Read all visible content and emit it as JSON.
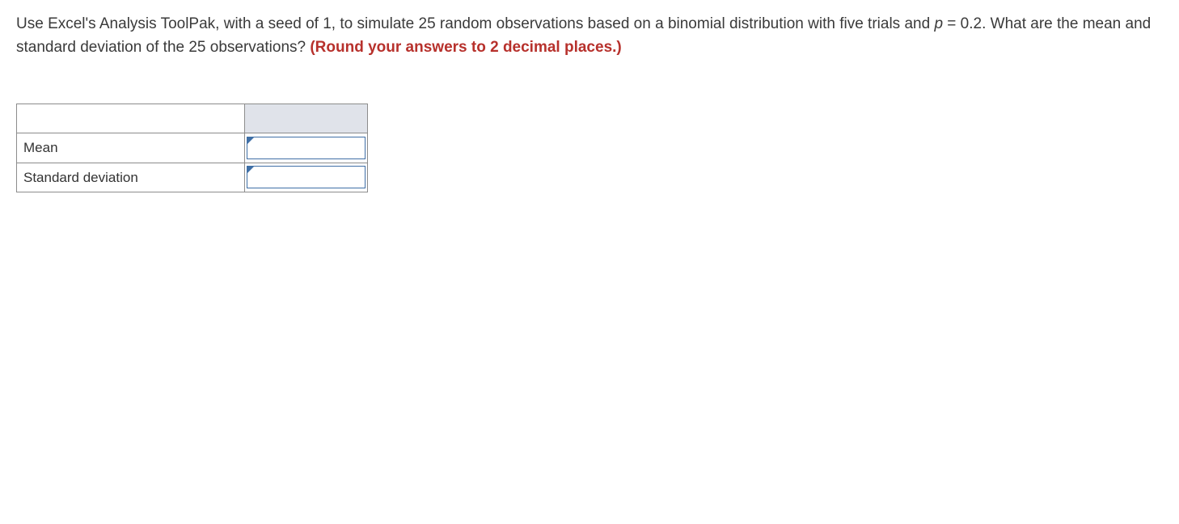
{
  "question": {
    "part1": "Use Excel's Analysis ToolPak, with a seed of 1, to simulate 25 random observations based on a binomial distribution with five trials and ",
    "italic_var": "p",
    "part2": " = 0.2. What are the mean and standard deviation of the 25 observations? ",
    "instruction": "(Round your answers to 2 decimal places.)"
  },
  "table": {
    "rows": [
      {
        "label": "Mean",
        "value": ""
      },
      {
        "label": "Standard deviation",
        "value": ""
      }
    ]
  }
}
